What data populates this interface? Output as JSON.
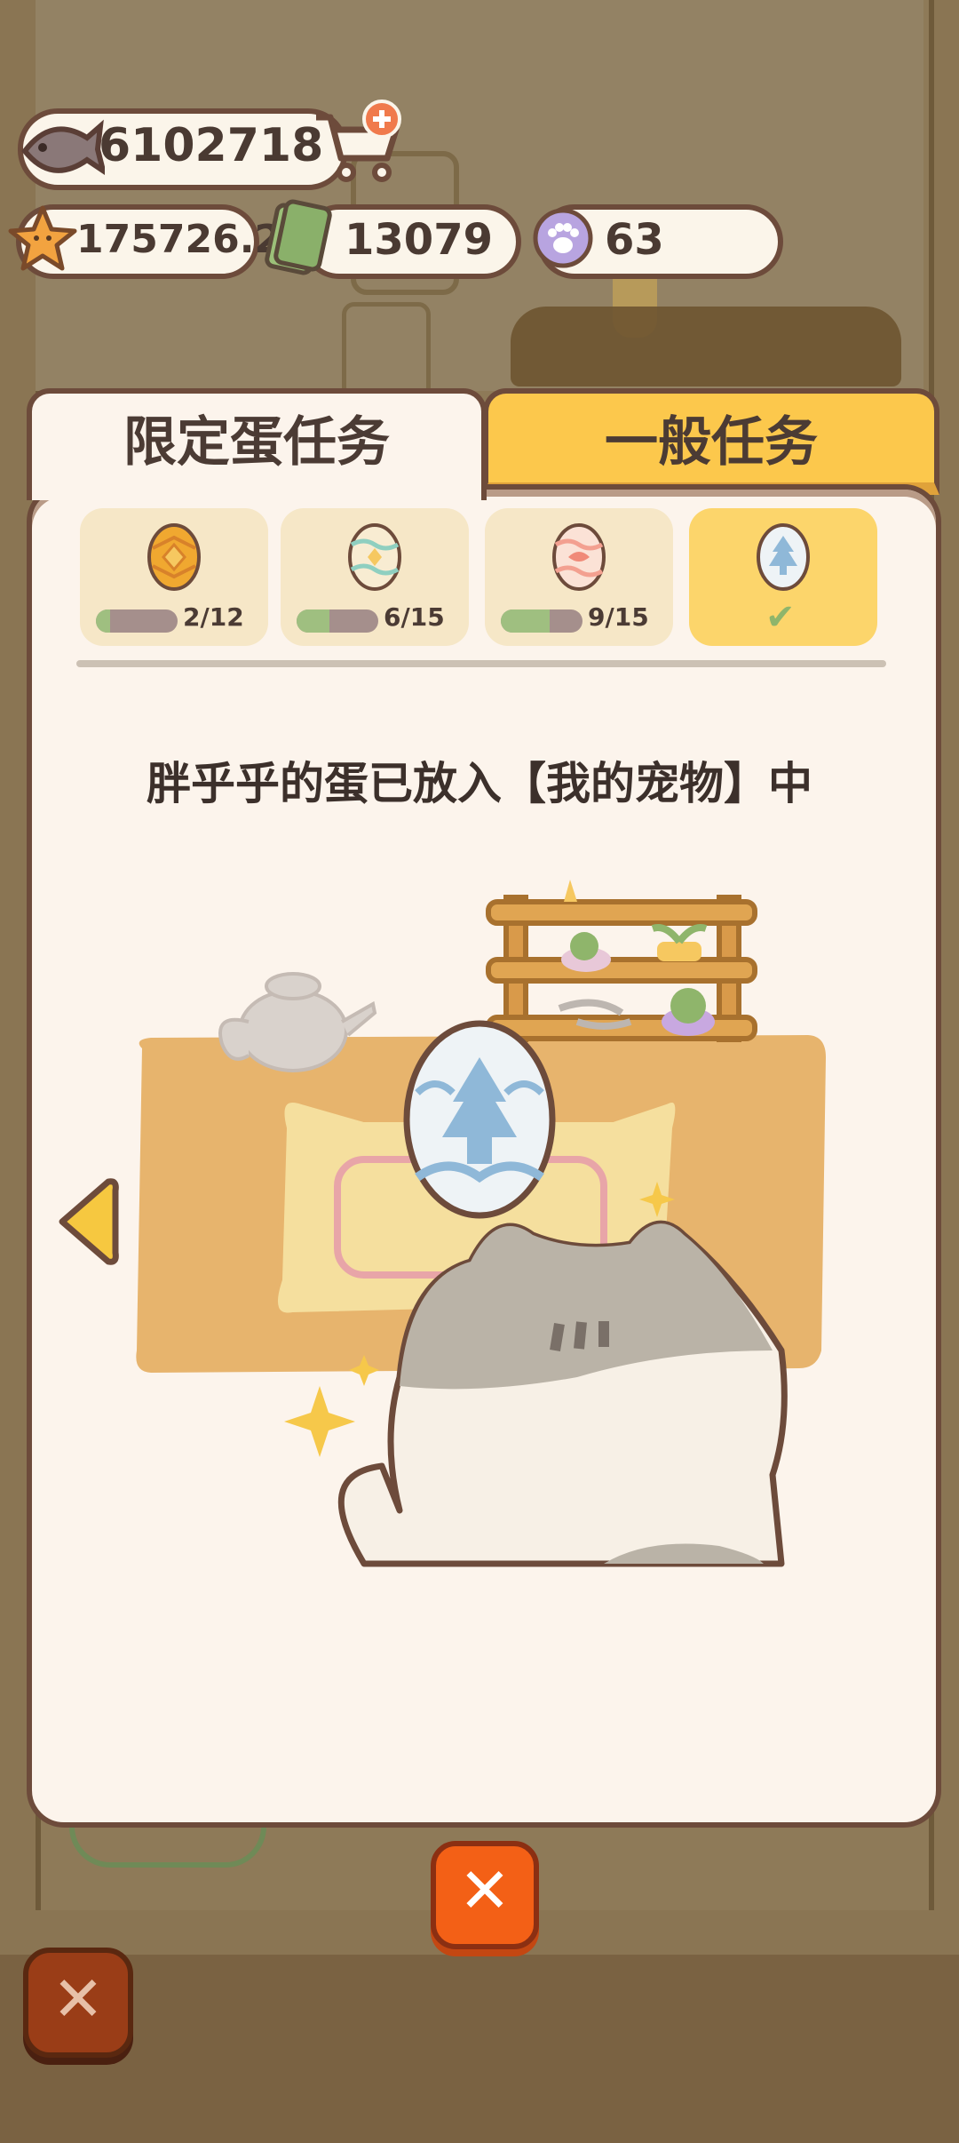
{
  "currencies": {
    "fish": "6102718",
    "stars": "175726.2",
    "cash": "13079",
    "paws": "63"
  },
  "tabs": {
    "limited": "限定蛋任务",
    "general": "一般任务"
  },
  "eggs": [
    {
      "progress_text": "2/12",
      "progress": 0.17,
      "color": "#f0a830"
    },
    {
      "progress_text": "6/15",
      "progress": 0.4,
      "color": "#8fcfc0"
    },
    {
      "progress_text": "9/15",
      "progress": 0.6,
      "color": "#f3a090"
    },
    {
      "progress_text": "",
      "completed": true,
      "color": "#9cbfe0"
    }
  ],
  "message": "胖乎乎的蛋已放入【我的宠物】中",
  "colors": {
    "tab_active_bg": "#fcf4ec",
    "tab_inactive_bg": "#fcc84c",
    "close_button": "#f36016"
  }
}
